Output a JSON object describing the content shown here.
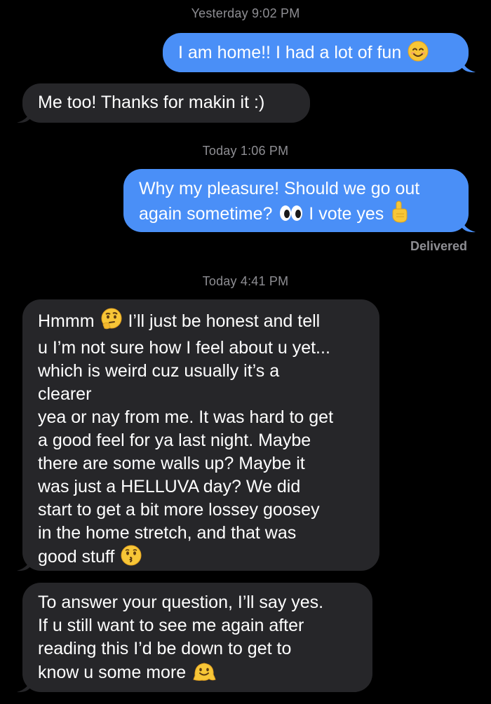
{
  "colors": {
    "background": "#000000",
    "sent_bubble": "#4a8ff7",
    "received_bubble": "#262629",
    "meta_text": "#8e8e93"
  },
  "timestamps": {
    "first": "Yesterday 9:02 PM",
    "second": "Today 1:06 PM",
    "third": "Today 4:41 PM"
  },
  "messages": [
    {
      "direction": "sent",
      "lines": [
        "I am home!! I had a lot of fun"
      ],
      "emoji": "smiling-face-icon"
    },
    {
      "direction": "received",
      "lines": [
        "Me too! Thanks for makin it :)"
      ]
    },
    {
      "direction": "sent",
      "lines": [
        "Why my pleasure! Should we go out",
        "again sometime?",
        "I vote yes"
      ],
      "emoji": [
        "eyes-icon",
        "index-pointing-up-icon"
      ]
    },
    {
      "direction": "received",
      "lines": [
        "Hmmm",
        "I’ll just be honest and tell",
        "u I’m not sure how I feel about u yet...",
        "which is weird cuz usually it’s a",
        "clearer",
        "yea or nay from me. It was hard to get",
        "a good feel for ya last night. Maybe",
        "there are some walls up? Maybe it",
        "was just a HELLUVA day? We did",
        "start to get a bit more lossey goosey",
        "in the home stretch, and that was",
        "good stuff"
      ],
      "emoji": [
        "thinking-face-icon",
        "kissing-face-icon"
      ]
    },
    {
      "direction": "received",
      "lines": [
        "To answer your question, I’ll say yes.",
        "If u still want to see me again after",
        "reading this I’d be down to get to",
        "know u some more"
      ],
      "emoji": "melting-face-icon"
    }
  ],
  "status": {
    "delivered": "Delivered"
  }
}
